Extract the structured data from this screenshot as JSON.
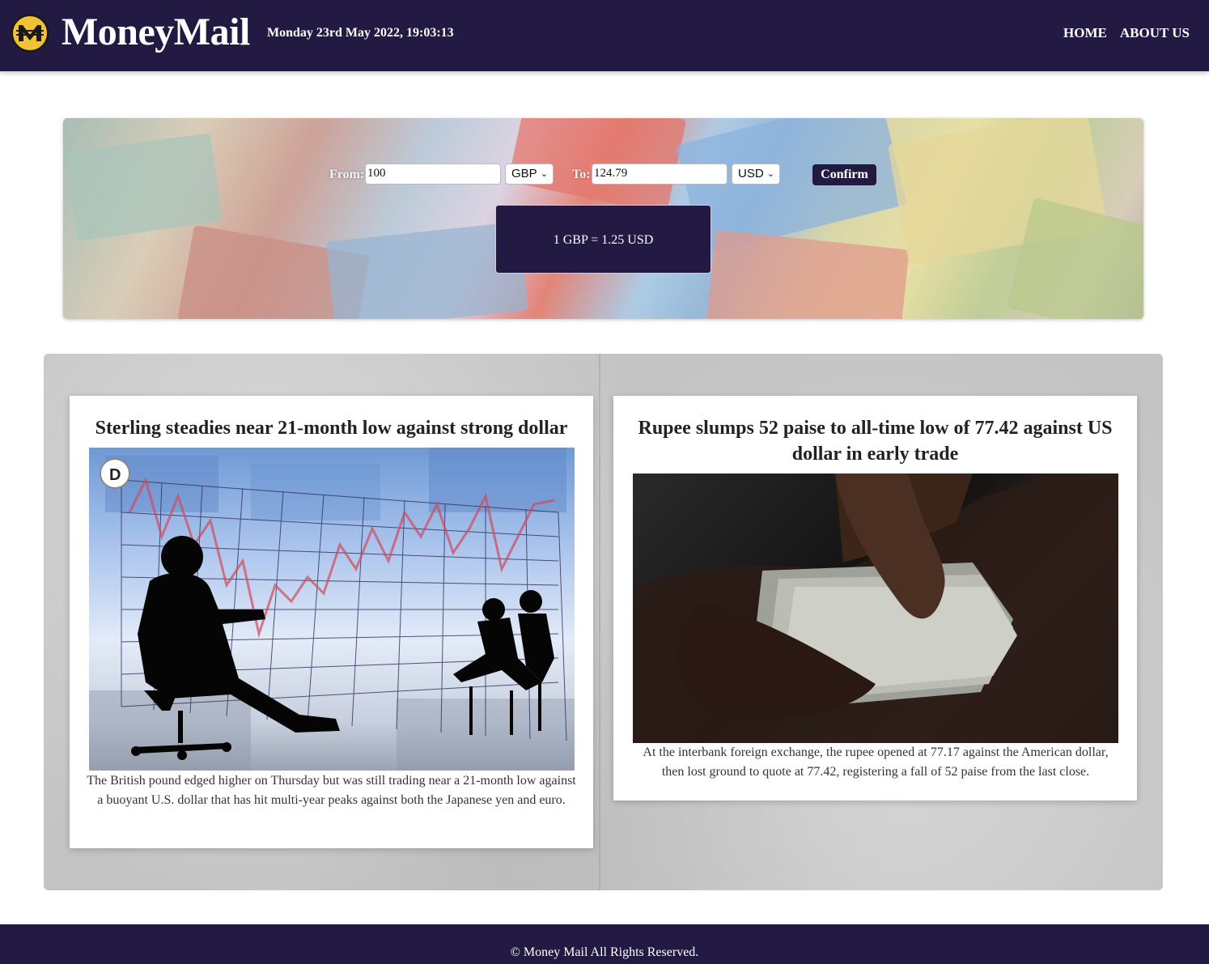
{
  "header": {
    "brand": "MoneyMail",
    "datetime": "Monday 23rd May 2022, 19:03:13",
    "nav": [
      "HOME",
      "ABOUT US"
    ]
  },
  "converter": {
    "from_label": "From:",
    "from_value": "100",
    "from_currency": "GBP",
    "to_label": "To:",
    "to_value": "124.79",
    "to_currency": "USD",
    "confirm_label": "Confirm",
    "rate_text": "1 GBP = 1.25 USD"
  },
  "articles": [
    {
      "title": "Sterling steadies near 21-month low against strong dollar",
      "summary": "The British pound edged higher on Thursday but was still trading near a 21-month low against a buoyant U.S. dollar that has hit multi-year peaks against both the Japanese yen and euro."
    },
    {
      "title": "Rupee slumps 52 paise to all-time low of 77.42 against US dollar in early trade",
      "summary": "At the interbank foreign exchange, the rupee opened at 77.17 against the American dollar, then lost ground to quote at 77.42, registering a fall of 52 paise from the last close."
    }
  ],
  "footer": {
    "text": "© Money Mail All Rights Reserved."
  },
  "colors": {
    "brand_navy": "#221a43",
    "logo_gold": "#f1c232"
  }
}
